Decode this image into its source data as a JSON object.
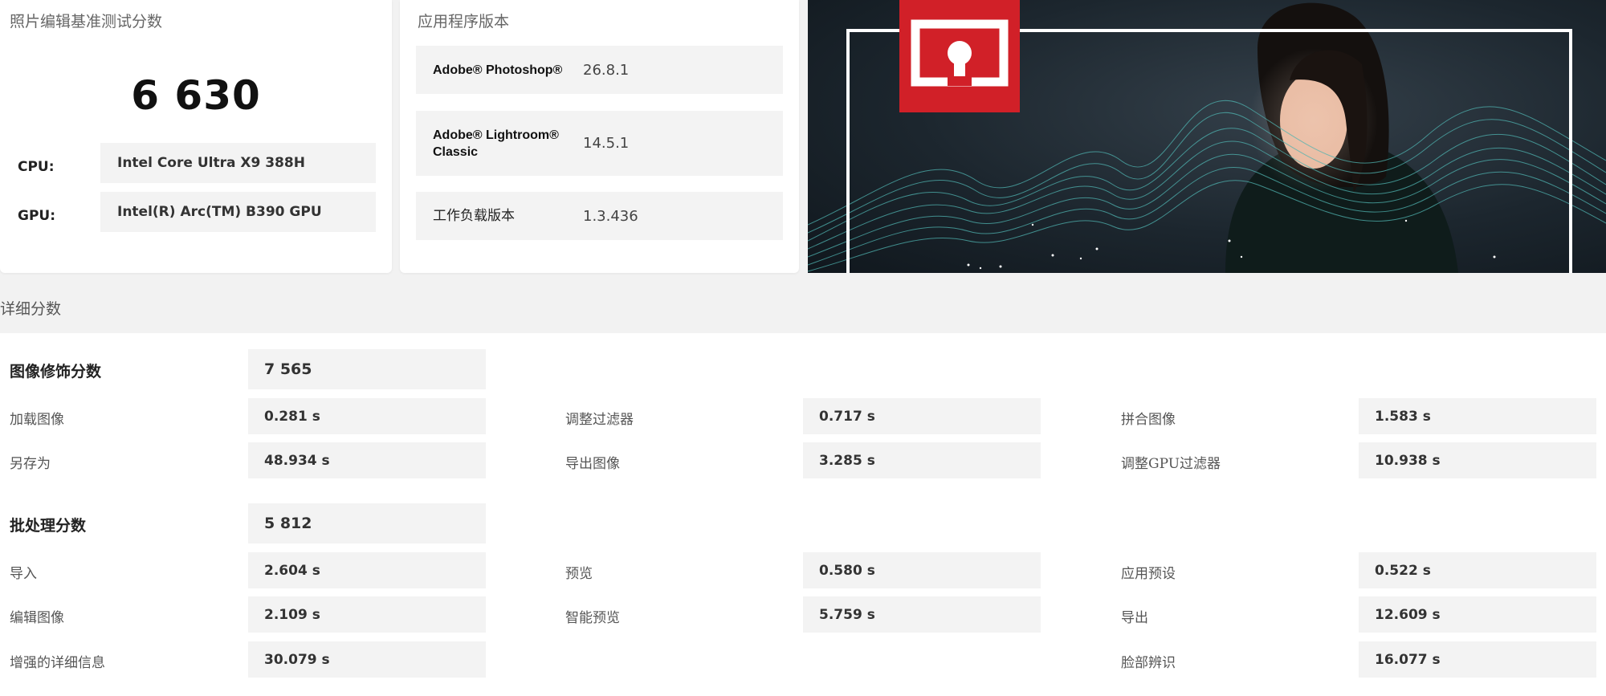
{
  "score_card": {
    "title": "照片编辑基准测试分数",
    "score": "6 630",
    "cpu_label": "CPU:",
    "cpu_value": "Intel Core Ultra X9 388H",
    "gpu_label": "GPU:",
    "gpu_value": "Intel(R) Arc(TM) B390 GPU"
  },
  "version_card": {
    "title": "应用程序版本",
    "rows": [
      {
        "name": "Adobe® Photoshop®",
        "value": "26.8.1"
      },
      {
        "name": "Adobe® Lightroom® Classic",
        "value": "14.5.1"
      },
      {
        "name": "工作负载版本",
        "value": "1.3.436"
      }
    ]
  },
  "hero": {
    "logo_icon": "ul-procyon-logo-icon",
    "accent_color": "#d12028",
    "wave_color": "#4fb3b0"
  },
  "details": {
    "title": "详细分数",
    "retouch": {
      "label": "图像修饰分数",
      "score": "7 565",
      "items": [
        {
          "label": "加载图像",
          "value": "0.281 s"
        },
        {
          "label": "调整过滤器",
          "value": "0.717 s"
        },
        {
          "label": "拼合图像",
          "value": "1.583 s"
        },
        {
          "label": "另存为",
          "value": "48.934 s"
        },
        {
          "label": "导出图像",
          "value": "3.285 s"
        },
        {
          "label": "调整GPU过滤器",
          "value": "10.938 s"
        }
      ]
    },
    "batch": {
      "label": "批处理分数",
      "score": "5 812",
      "items": [
        {
          "label": "导入",
          "value": "2.604 s"
        },
        {
          "label": "预览",
          "value": "0.580 s"
        },
        {
          "label": "应用预设",
          "value": "0.522 s"
        },
        {
          "label": "编辑图像",
          "value": "2.109 s"
        },
        {
          "label": "智能预览",
          "value": "5.759 s"
        },
        {
          "label": "导出",
          "value": "12.609 s"
        },
        {
          "label": "增强的详细信息",
          "value": "30.079 s"
        },
        {
          "label": "脸部辨识",
          "value": "16.077 s"
        }
      ]
    }
  }
}
